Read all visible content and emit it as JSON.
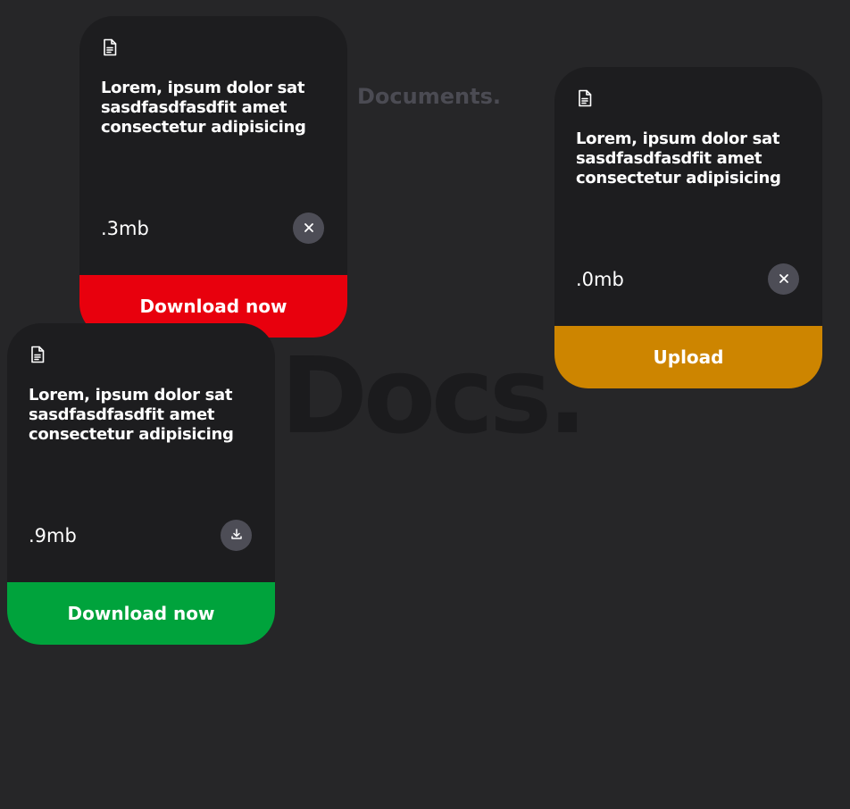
{
  "background_title": "Docs.",
  "subtitle": "Documents.",
  "colors": {
    "background": "#262628",
    "card": "#1d1d1f",
    "download_red": "#e8000d",
    "upload_orange": "#cd8500",
    "download_green": "#00a33c"
  },
  "cards": [
    {
      "icon": "document-icon",
      "title": "Lorem, ipsum dolor sat sasdfasdfasdfit amet consectetur adipisicing",
      "size": ".3mb",
      "round_button_icon": "close-icon",
      "action_label": "Download now"
    },
    {
      "icon": "document-icon",
      "title": "Lorem, ipsum dolor sat sasdfasdfasdfit amet consectetur adipisicing",
      "size": ".0mb",
      "round_button_icon": "close-icon",
      "action_label": "Upload"
    },
    {
      "icon": "document-icon",
      "title": "Lorem, ipsum dolor sat sasdfasdfasdfit amet consectetur adipisicing",
      "size": ".9mb",
      "round_button_icon": "download-icon",
      "action_label": "Download now"
    }
  ]
}
